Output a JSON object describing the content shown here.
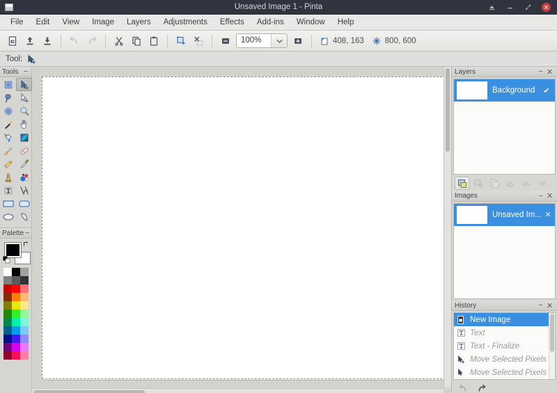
{
  "window": {
    "title": "Unsaved Image 1 - Pinta",
    "app_icon": "window-icon",
    "controls": [
      {
        "name": "shade-button",
        "glyph": "shade-icon"
      },
      {
        "name": "minimize-button",
        "glyph": "minimize-icon"
      },
      {
        "name": "maximize-button",
        "glyph": "maximize-icon"
      },
      {
        "name": "close-button",
        "glyph": "close-icon"
      }
    ],
    "titlebar_bg": "#2f343f",
    "accent": "#3a8fe0",
    "close_color": "#cf3b3b"
  },
  "menubar": {
    "items": [
      {
        "label": "File"
      },
      {
        "label": "Edit"
      },
      {
        "label": "View"
      },
      {
        "label": "Image"
      },
      {
        "label": "Layers"
      },
      {
        "label": "Adjustments"
      },
      {
        "label": "Effects"
      },
      {
        "label": "Add-ins"
      },
      {
        "label": "Window"
      },
      {
        "label": "Help"
      }
    ]
  },
  "toolbar": {
    "buttons": [
      {
        "name": "new-image-button",
        "icon": "new-document-icon",
        "enabled": true
      },
      {
        "name": "open-image-button",
        "icon": "open-folder-up-arrow-icon",
        "enabled": true
      },
      {
        "name": "save-image-button",
        "icon": "save-down-arrow-icon",
        "enabled": true
      },
      {
        "name": "undo-button",
        "icon": "undo-arrow-icon",
        "enabled": false
      },
      {
        "name": "redo-button",
        "icon": "redo-arrow-icon",
        "enabled": false
      },
      {
        "name": "cut-button",
        "icon": "scissors-icon",
        "enabled": true
      },
      {
        "name": "copy-button",
        "icon": "copy-pages-icon",
        "enabled": true
      },
      {
        "name": "paste-button",
        "icon": "clipboard-icon",
        "enabled": true
      },
      {
        "name": "crop-to-selection-button",
        "icon": "crop-selection-icon",
        "enabled": true
      },
      {
        "name": "deselect-all-button",
        "icon": "deselect-icon",
        "enabled": true
      }
    ],
    "zoom_out_label": "zoom-out-icon",
    "zoom_value": "100%",
    "zoom_dropdown_icon": "chevron-down-icon",
    "zoom_in_label": "zoom-in-icon",
    "cursor_position": "408, 163",
    "cursor_position_icon": "cursor-position-icon",
    "image_size": "800, 600",
    "image_size_icon": "selection-size-icon"
  },
  "toolstrip": {
    "label": "Tool:",
    "active_tool_icon": "move-selected-pixels-icon"
  },
  "tools_panel": {
    "title": "Tools",
    "minimize_glyph": "−",
    "items": [
      {
        "name": "tool-rectangle-select",
        "icon": "rect-select-icon",
        "active": false
      },
      {
        "name": "tool-move-selected",
        "icon": "move-selected-icon",
        "active": true
      },
      {
        "name": "tool-lasso-select",
        "icon": "lasso-select-icon",
        "active": false
      },
      {
        "name": "tool-move-selection",
        "icon": "move-selection-icon",
        "active": false
      },
      {
        "name": "tool-ellipse-select",
        "icon": "ellipse-select-icon",
        "active": false
      },
      {
        "name": "tool-zoom",
        "icon": "magnifier-icon",
        "active": false
      },
      {
        "name": "tool-magic-wand",
        "icon": "magic-wand-icon",
        "active": false
      },
      {
        "name": "tool-pan",
        "icon": "hand-pan-icon",
        "active": false
      },
      {
        "name": "tool-paint-bucket",
        "icon": "paint-bucket-icon",
        "active": false
      },
      {
        "name": "tool-gradient",
        "icon": "gradient-icon",
        "active": false
      },
      {
        "name": "tool-paintbrush",
        "icon": "paintbrush-icon",
        "active": false
      },
      {
        "name": "tool-eraser",
        "icon": "eraser-icon",
        "active": false
      },
      {
        "name": "tool-pencil",
        "icon": "pencil-icon",
        "active": false
      },
      {
        "name": "tool-color-picker",
        "icon": "eyedropper-icon",
        "active": false
      },
      {
        "name": "tool-clone-stamp",
        "icon": "clone-stamp-icon",
        "active": false
      },
      {
        "name": "tool-recolor",
        "icon": "recolor-icon",
        "active": false
      },
      {
        "name": "tool-text",
        "icon": "text-t-icon",
        "active": false
      },
      {
        "name": "tool-line-curve",
        "icon": "line-curve-icon",
        "active": false
      },
      {
        "name": "tool-rectangle",
        "icon": "rectangle-shape-icon",
        "active": false
      },
      {
        "name": "tool-rounded-rectangle",
        "icon": "rounded-rectangle-icon",
        "active": false
      },
      {
        "name": "tool-ellipse",
        "icon": "ellipse-shape-icon",
        "active": false
      },
      {
        "name": "tool-freeform-shape",
        "icon": "freeform-shape-icon",
        "active": false
      }
    ]
  },
  "palette_panel": {
    "title": "Palette",
    "minimize_glyph": "−",
    "primary_color": "#000000",
    "secondary_color": "#ffffff",
    "swap_icon": "swap-colors-icon",
    "reset_icon": "reset-colors-icon",
    "colors": [
      "#ffffff",
      "#000000",
      "#a0a0a0",
      "#808080",
      "#5a5a5a",
      "#2f3438",
      "#c80000",
      "#ff0000",
      "#ff6f7a",
      "#8a2800",
      "#ff7f00",
      "#f7bb77",
      "#7f7f00",
      "#e8e800",
      "#fbe88a",
      "#1f8a00",
      "#2cf22c",
      "#96f49a",
      "#008a4a",
      "#00f0b4",
      "#7ef8dd",
      "#00628f",
      "#00a0ef",
      "#7dc9f7",
      "#000f8a",
      "#4617f2",
      "#8e8bf7",
      "#72007f",
      "#d800ef",
      "#e57df7",
      "#8f0030",
      "#ff1055",
      "#ff7fa5"
    ]
  },
  "canvas": {
    "background": "#ffffff",
    "zoom": "100%"
  },
  "layers_panel": {
    "title": "Layers",
    "minimize_glyph": "−",
    "close_glyph": "✕",
    "layers": [
      {
        "name": "Background",
        "visible": true,
        "selected": true,
        "check_glyph": "✔"
      }
    ],
    "buttons": [
      {
        "name": "add-layer-button",
        "icon": "add-layer-icon",
        "enabled": true
      },
      {
        "name": "delete-layer-button",
        "icon": "delete-layer-icon",
        "enabled": false
      },
      {
        "name": "duplicate-layer-button",
        "icon": "duplicate-layer-icon",
        "enabled": false
      },
      {
        "name": "merge-layer-down-button",
        "icon": "merge-down-icon",
        "enabled": false
      },
      {
        "name": "move-layer-up-button",
        "icon": "move-up-icon",
        "enabled": false
      },
      {
        "name": "move-layer-down-button",
        "icon": "move-down-icon",
        "enabled": false
      }
    ]
  },
  "images_panel": {
    "title": "Images",
    "minimize_glyph": "−",
    "close_glyph": "✕",
    "images": [
      {
        "name": "Unsaved Im...",
        "selected": true,
        "close_glyph": "✕"
      }
    ]
  },
  "history_panel": {
    "title": "History",
    "minimize_glyph": "−",
    "close_glyph": "✕",
    "items": [
      {
        "label": "New Image",
        "icon": "new-image-icon",
        "state": "current"
      },
      {
        "label": "Text",
        "icon": "text-t-icon",
        "state": "undone"
      },
      {
        "label": "Text - Finalize",
        "icon": "text-t-icon",
        "state": "undone"
      },
      {
        "label": "Move Selected Pixels",
        "icon": "move-selected-icon",
        "state": "undone"
      },
      {
        "label": "Move Selected Pixels",
        "icon": "move-selected-icon",
        "state": "undone"
      }
    ],
    "buttons": [
      {
        "name": "history-undo-button",
        "icon": "undo-arrow-icon",
        "enabled": false
      },
      {
        "name": "history-redo-button",
        "icon": "redo-arrow-icon",
        "enabled": true
      }
    ]
  }
}
